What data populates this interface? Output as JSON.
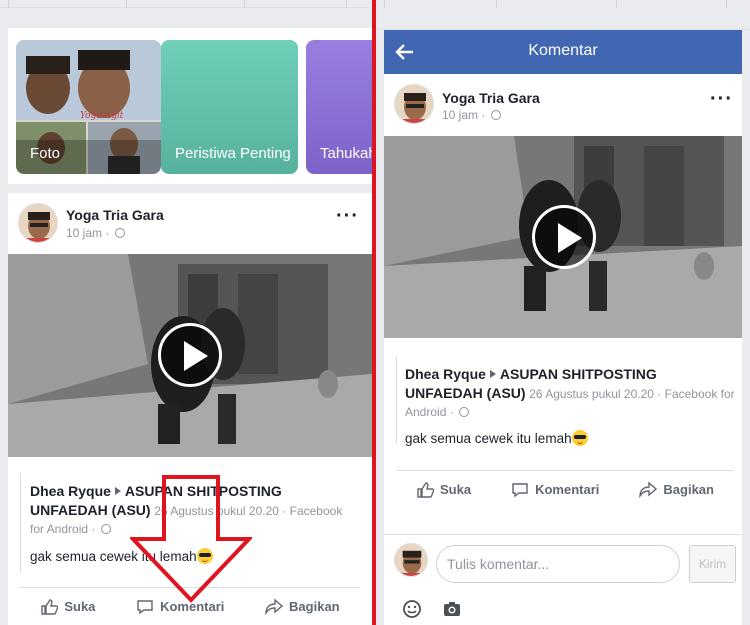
{
  "left": {
    "stories": [
      {
        "label": "Foto"
      },
      {
        "label": "Peristiwa Penting"
      },
      {
        "label": "Tahukah"
      }
    ],
    "post": {
      "author": "Yoga Tria Gara",
      "time": "10 jam · ",
      "shared_author": "Dhea Ryque",
      "shared_group": "ASUPAN SHITPOSTING UNFAEDAH (ASU)",
      "shared_date": "26 Agustus pukul 20.20 · Facebook for Android · ",
      "text": "gak semua cewek itu lemah",
      "actions": {
        "like": "Suka",
        "comment": "Komentari",
        "share": "Bagikan"
      }
    }
  },
  "right": {
    "header_title": "Komentar",
    "post": {
      "author": "Yoga Tria Gara",
      "time": "10 jam · ",
      "shared_author": "Dhea Ryque",
      "shared_group": "ASUPAN SHITPOSTING UNFAEDAH (ASU)",
      "shared_date": "26 Agustus pukul 20.20 · Facebook for Android · ",
      "text": "gak semua cewek itu lemah",
      "actions": {
        "like": "Suka",
        "comment": "Komentari",
        "share": "Bagikan"
      }
    },
    "composer": {
      "placeholder": "Tulis komentar...",
      "send_label": "Kirim"
    }
  },
  "colors": {
    "fb_blue": "#4267b2",
    "divider_red": "#e0141e",
    "annotation_arrow": "#e0141e"
  },
  "icons": [
    "back-arrow-icon",
    "more-dots-icon",
    "globe-icon",
    "play-icon",
    "like-icon",
    "comment-icon",
    "share-icon",
    "sunglasses-emoji-icon",
    "emoji-picker-icon",
    "camera-icon"
  ]
}
